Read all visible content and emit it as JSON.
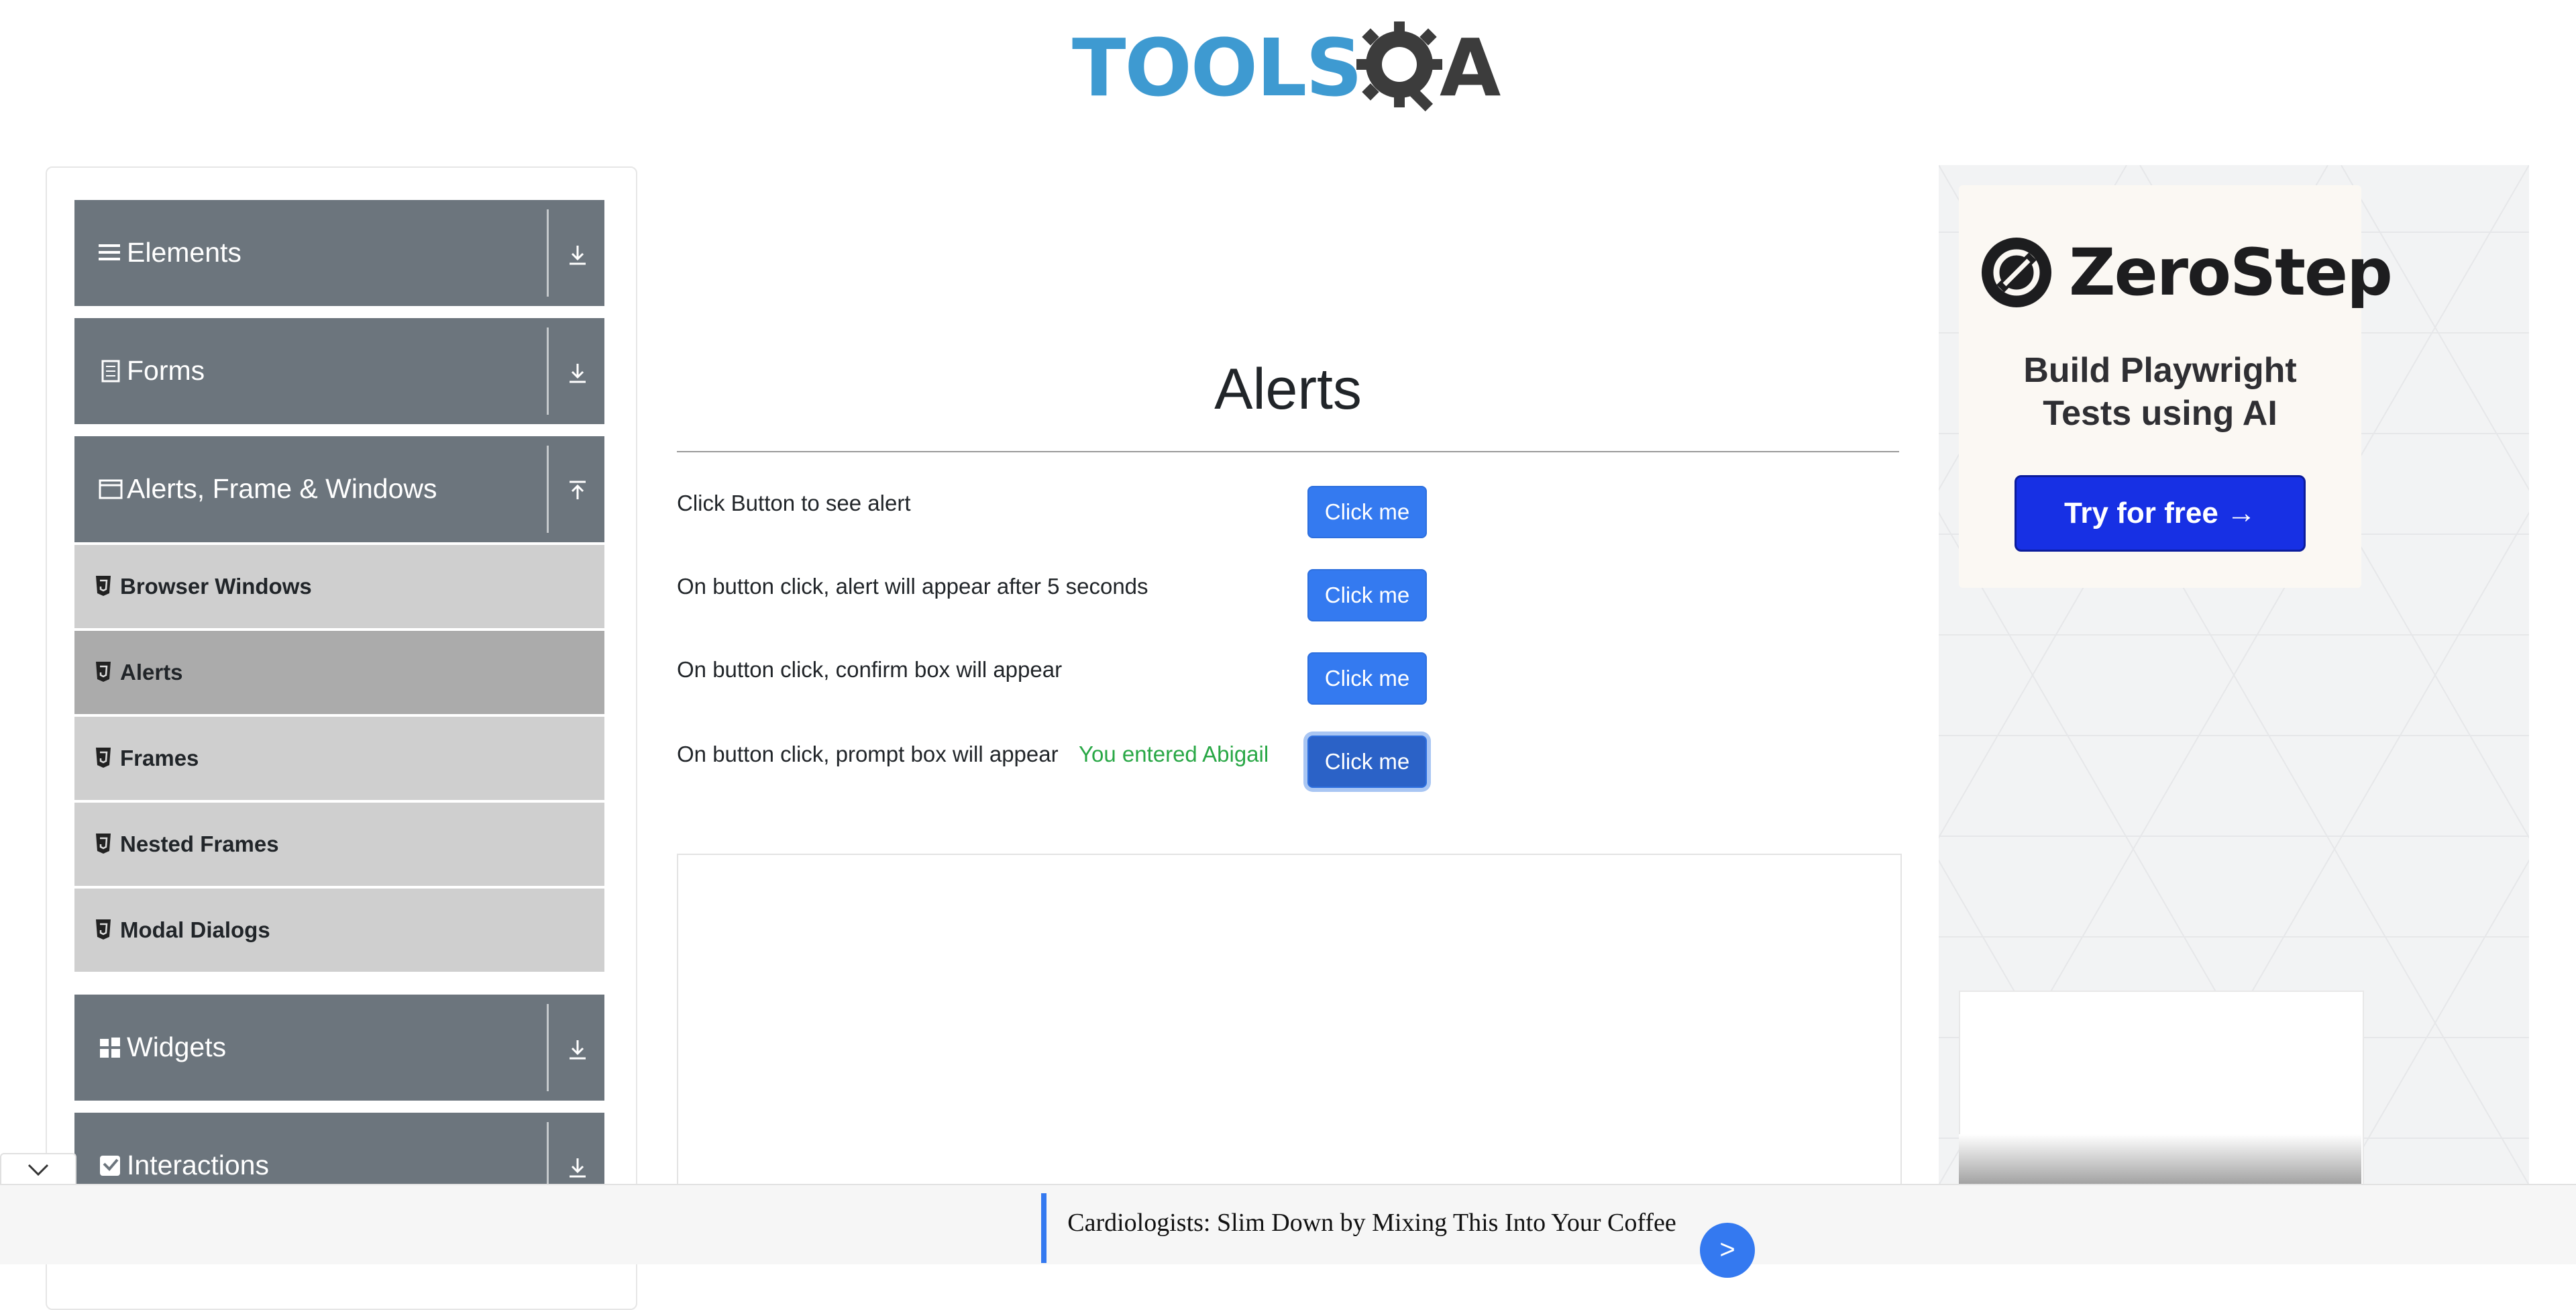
{
  "header": {
    "logo_tools": "TOOLS",
    "logo_a": "A"
  },
  "sidebar": {
    "groups": [
      {
        "label": "Elements",
        "icon": "hamburger-icon",
        "toggle": "download-icon"
      },
      {
        "label": "Forms",
        "icon": "document-icon",
        "toggle": "download-icon"
      },
      {
        "label": "Alerts, Frame & Windows",
        "icon": "window-icon",
        "toggle": "upload-icon"
      },
      {
        "label": "Widgets",
        "icon": "grid-icon",
        "toggle": "download-icon"
      },
      {
        "label": "Interactions",
        "icon": "interaction-icon",
        "toggle": "download-icon"
      }
    ],
    "sub_items": [
      {
        "label": "Browser Windows",
        "active": false
      },
      {
        "label": "Alerts",
        "active": true
      },
      {
        "label": "Frames",
        "active": false
      },
      {
        "label": "Nested Frames",
        "active": false
      },
      {
        "label": "Modal Dialogs",
        "active": false
      }
    ]
  },
  "main": {
    "title": "Alerts",
    "rows": [
      {
        "label": "Click Button to see alert",
        "button": "Click me"
      },
      {
        "label": "On button click, alert will appear after 5 seconds",
        "button": "Click me"
      },
      {
        "label": "On button click, confirm box will appear",
        "button": "Click me"
      },
      {
        "label": "On button click, prompt box will appear",
        "button": "Click me"
      }
    ],
    "prompt_result": "You entered Abigail"
  },
  "ad": {
    "brand": "ZeroStep",
    "tagline_line1": "Build Playwright",
    "tagline_line2": "Tests using AI",
    "cta": "Try for free →"
  },
  "bottom_ad": {
    "headline": "Cardiologists: Slim Down by Mixing This Into Your Coffee",
    "go": ">"
  },
  "colors": {
    "sidebar_header": "#6c757d",
    "sub_item": "#cfcfcf",
    "sub_item_active": "#ababab",
    "button": "#347af0",
    "success_text": "#28a745",
    "logo_blue": "#3e9ad1",
    "cta_blue": "#1730e4"
  }
}
